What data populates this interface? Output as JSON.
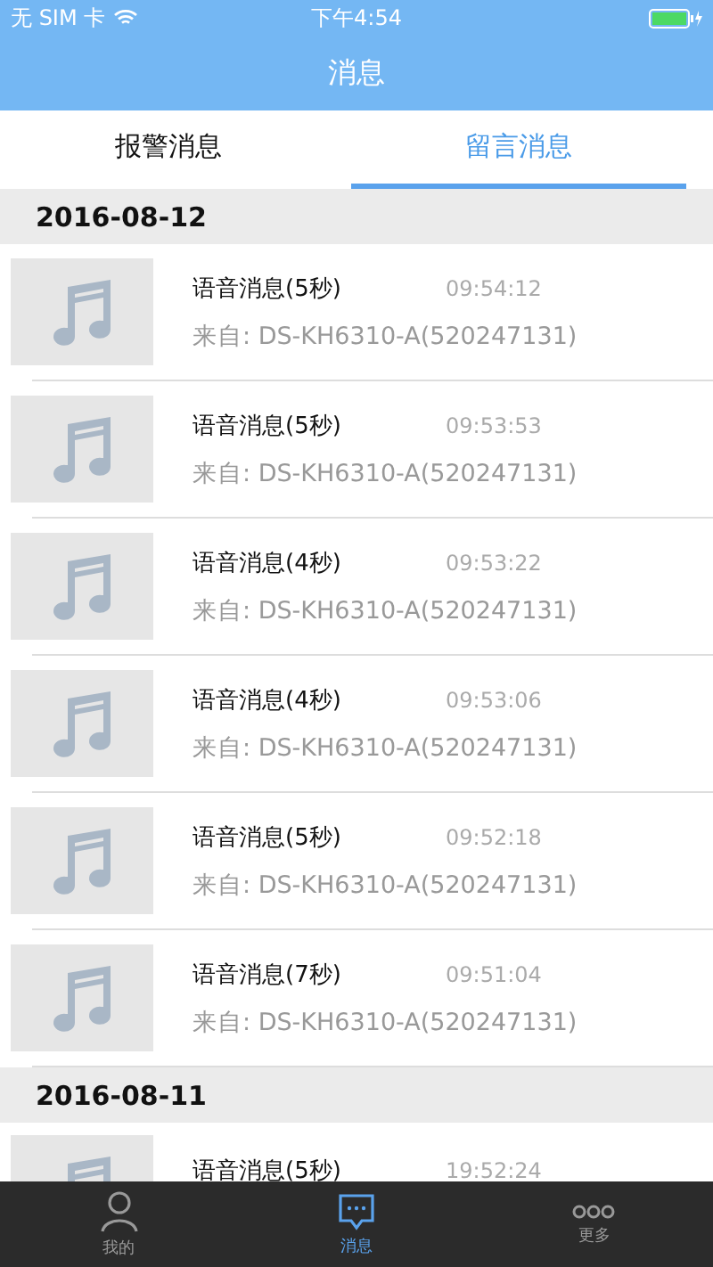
{
  "status_bar": {
    "carrier": "无 SIM 卡",
    "time": "下午4:54"
  },
  "nav_bar": {
    "title": "消息"
  },
  "tabs": [
    {
      "label": "报警消息",
      "selected": false
    },
    {
      "label": "留言消息",
      "selected": true
    }
  ],
  "sections": [
    {
      "date": "2016-08-12",
      "items": [
        {
          "title": "语音消息(5秒)",
          "time": "09:54:12",
          "from": "来自: DS-KH6310-A(520247131)"
        },
        {
          "title": "语音消息(5秒)",
          "time": "09:53:53",
          "from": "来自: DS-KH6310-A(520247131)"
        },
        {
          "title": "语音消息(4秒)",
          "time": "09:53:22",
          "from": "来自: DS-KH6310-A(520247131)"
        },
        {
          "title": "语音消息(4秒)",
          "time": "09:53:06",
          "from": "来自: DS-KH6310-A(520247131)"
        },
        {
          "title": "语音消息(5秒)",
          "time": "09:52:18",
          "from": "来自: DS-KH6310-A(520247131)"
        },
        {
          "title": "语音消息(7秒)",
          "time": "09:51:04",
          "from": "来自: DS-KH6310-A(520247131)"
        }
      ]
    },
    {
      "date": "2016-08-11",
      "items": [
        {
          "title": "语音消息(5秒)",
          "time": "19:52:24"
        }
      ]
    }
  ],
  "tab_bar": [
    {
      "kind": "person",
      "label": "我的",
      "selected": false
    },
    {
      "kind": "chat",
      "label": "消息",
      "selected": true
    },
    {
      "kind": "more",
      "label": "更多",
      "selected": false
    }
  ]
}
